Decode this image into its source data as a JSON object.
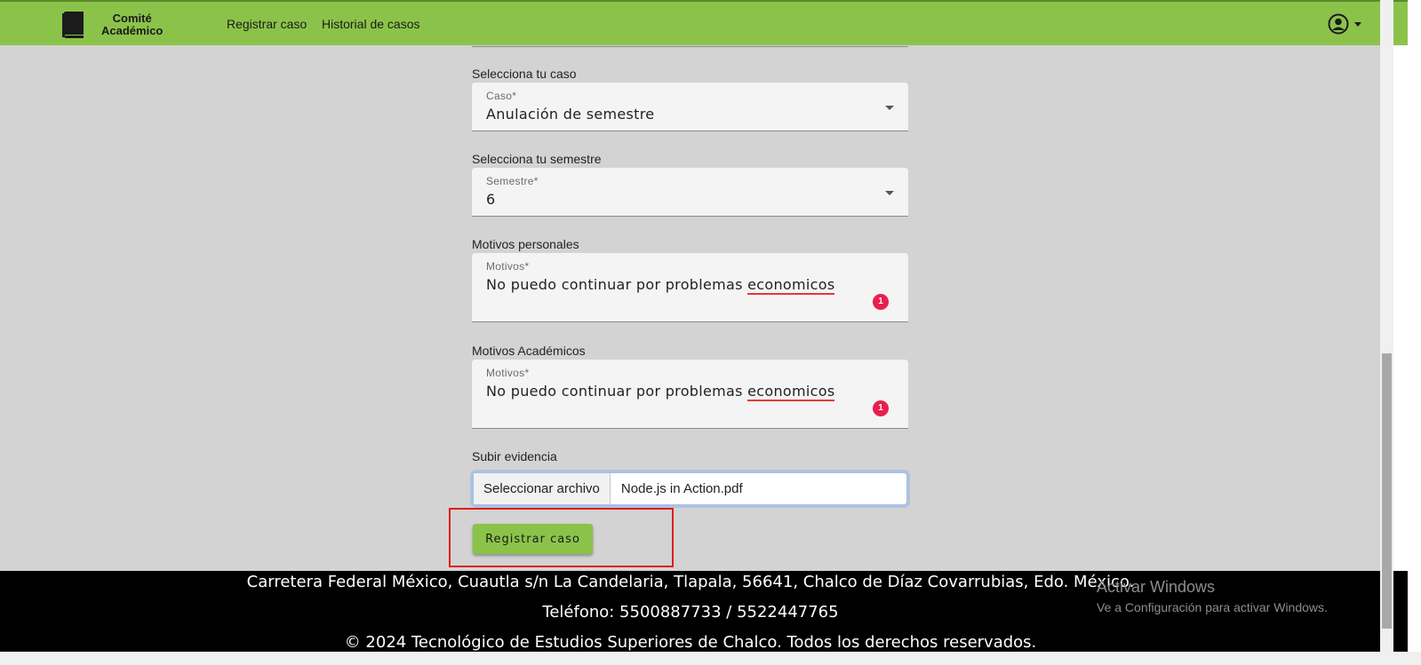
{
  "navbar": {
    "brand_line1": "Comité",
    "brand_line2": "Académico",
    "links": [
      "Registrar caso",
      "Historial de casos"
    ],
    "bg_color": "#8bc34a"
  },
  "form": {
    "caso_section": "Selecciona tu caso",
    "caso_label": "Caso*",
    "caso_value": "Anulación de semestre",
    "semestre_section": "Selecciona tu semestre",
    "semestre_label": "Semestre*",
    "semestre_value": "6",
    "personales_section": "Motivos personales",
    "personales_label": "Motivos*",
    "personales_prefix": "No puedo continuar por problemas ",
    "personales_spell": "economicos",
    "personales_badge": "1",
    "academicos_section": "Motivos Académicos",
    "academicos_label": "Motivos*",
    "academicos_prefix": "No puedo continuar por problemas ",
    "academicos_spell": "economicos",
    "academicos_badge": "1",
    "evidencia_section": "Subir evidencia",
    "file_button": "Seleccionar archivo",
    "file_name": "Node.js in Action.pdf",
    "submit_label": "Registrar caso"
  },
  "footer": {
    "address": "Carretera Federal México, Cuautla s/n La Candelaria, Tlapala, 56641, Chalco de Díaz Covarrubias, Edo. México.",
    "phone": "Teléfono: 5500887733 / 5522447765",
    "copyright": "© 2024 Tecnológico de Estudios Superiores de Chalco. Todos los derechos reservados."
  },
  "watermark": {
    "title": "Activar Windows",
    "subtitle": "Ve a Configuración para activar Windows."
  },
  "icons": [
    "book-icon",
    "user-circle-icon",
    "chevron-down-icon"
  ]
}
